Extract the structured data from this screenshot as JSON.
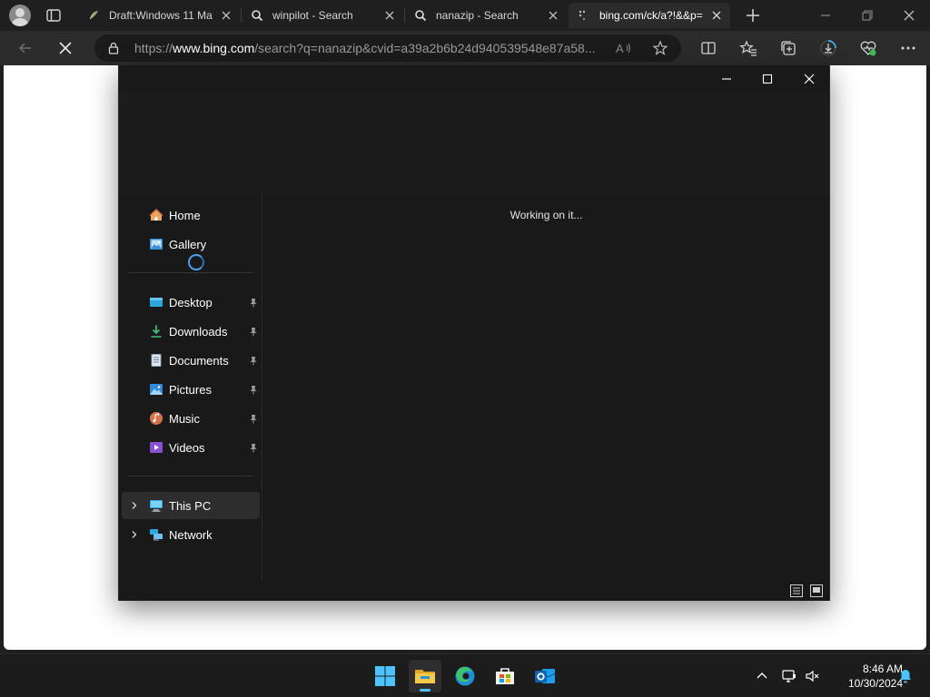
{
  "browser": {
    "tabs": [
      {
        "title": "Draft:Windows 11 Ma",
        "icon": "wikipedia-favicon",
        "active": false
      },
      {
        "title": "winpilot - Search",
        "icon": "search-favicon",
        "active": false
      },
      {
        "title": "nanazip - Search",
        "icon": "search-favicon",
        "active": false
      },
      {
        "title": "bing.com/ck/a?!&&p=",
        "icon": "loading-favicon",
        "active": true
      }
    ],
    "address": {
      "scheme": "https://",
      "host": "www.bing.com",
      "path": "/search?q=nanazip&cvid=a39a2b6b24d940539548e87a58..."
    }
  },
  "explorer": {
    "sidebar": {
      "quick": [
        {
          "label": "Home",
          "icon": "home-icon"
        },
        {
          "label": "Gallery",
          "icon": "gallery-icon"
        }
      ],
      "pinned": [
        {
          "label": "Desktop",
          "icon": "desktop-folder-icon"
        },
        {
          "label": "Downloads",
          "icon": "downloads-folder-icon"
        },
        {
          "label": "Documents",
          "icon": "documents-folder-icon"
        },
        {
          "label": "Pictures",
          "icon": "pictures-folder-icon"
        },
        {
          "label": "Music",
          "icon": "music-folder-icon"
        },
        {
          "label": "Videos",
          "icon": "videos-folder-icon"
        }
      ],
      "locations": [
        {
          "label": "This PC",
          "icon": "this-pc-icon",
          "selected": true
        },
        {
          "label": "Network",
          "icon": "network-icon",
          "selected": false
        }
      ]
    },
    "status_message": "Working on it..."
  },
  "taskbar": {
    "apps": [
      {
        "name": "Start",
        "icon": "windows-start-icon"
      },
      {
        "name": "File Explorer",
        "icon": "file-explorer-icon",
        "running": true
      },
      {
        "name": "Microsoft Edge",
        "icon": "edge-icon"
      },
      {
        "name": "Microsoft Store",
        "icon": "store-icon"
      },
      {
        "name": "Outlook",
        "icon": "outlook-icon"
      }
    ],
    "clock": {
      "time": "8:46 AM",
      "date": "10/30/2024"
    }
  },
  "colors": {
    "accent": "#4cc2ff",
    "spinner": "#4aa3f0",
    "explorer_bg": "#191919",
    "page_bg": "#ffffff"
  }
}
